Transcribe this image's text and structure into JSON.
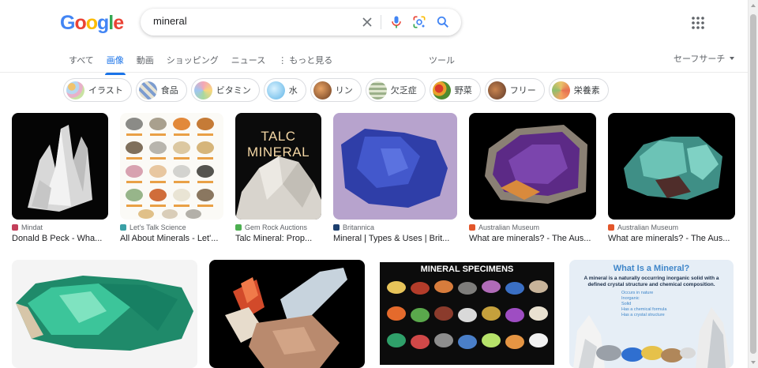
{
  "logo": [
    "G",
    "o",
    "o",
    "g",
    "l",
    "e"
  ],
  "search": {
    "query": "mineral"
  },
  "tabs": [
    {
      "label": "すべて",
      "active": false
    },
    {
      "label": "画像",
      "active": true
    },
    {
      "label": "動画",
      "active": false
    },
    {
      "label": "ショッピング",
      "active": false
    },
    {
      "label": "ニュース",
      "active": false
    },
    {
      "label": "⋮ もっと見る",
      "active": false
    }
  ],
  "tools_label": "ツール",
  "safesearch_label": "セーフサーチ",
  "chips": [
    {
      "label": "イラスト"
    },
    {
      "label": "食品"
    },
    {
      "label": "ビタミン"
    },
    {
      "label": "水"
    },
    {
      "label": "リン"
    },
    {
      "label": "欠乏症"
    },
    {
      "label": "野菜"
    },
    {
      "label": "フリー"
    },
    {
      "label": "栄養素"
    }
  ],
  "results_row1": [
    {
      "source": "Mindat",
      "title": "Donald B Peck - Wha...",
      "fav_color": "#c33f5a"
    },
    {
      "source": "Let's Talk Science",
      "title": "All About Minerals - Let'...",
      "fav_color": "#3aa0a6"
    },
    {
      "source": "Gem Rock Auctions",
      "title": "Talc Mineral: Prop...",
      "fav_color": "#4caf50"
    },
    {
      "source": "Britannica",
      "title": "Mineral | Types & Uses | Brit...",
      "fav_color": "#1c3f6e"
    },
    {
      "source": "Australian Museum",
      "title": "What are minerals? - The Aus...",
      "fav_color": "#e2562b"
    },
    {
      "source": "Australian Museum",
      "title": "What are minerals? - The Aus...",
      "fav_color": "#e2562b"
    }
  ],
  "image_text": {
    "talc": "TALC MINERAL",
    "specimens": "MINERAL SPECIMENS",
    "what_is_title": "What Is a Mineral?",
    "what_is_sub": "A mineral is a naturally occurring inorganic solid with a defined crystal structure and chemical composition.",
    "what_is_points": [
      "Occurs in nature",
      "Inorganic",
      "Solid",
      "Has a chemical formula",
      "Has a crystal structure"
    ]
  }
}
